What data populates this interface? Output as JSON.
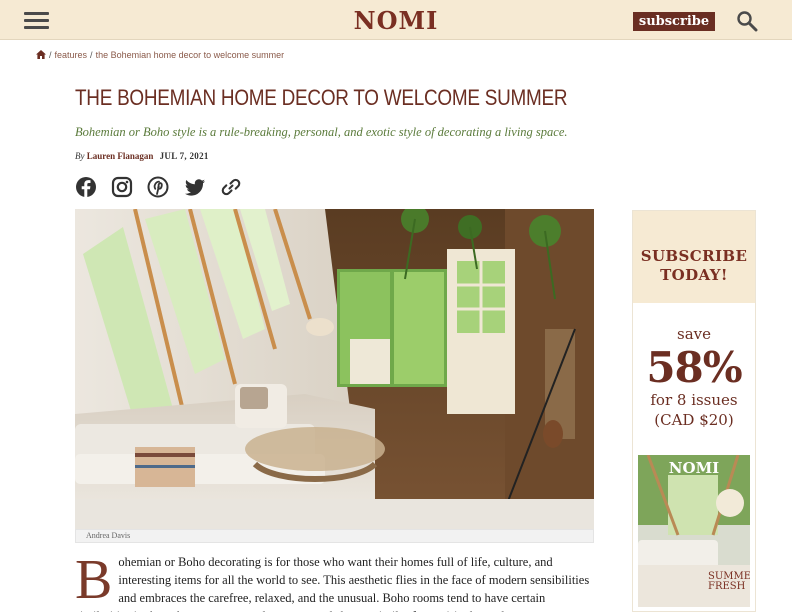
{
  "header": {
    "brand": "NOMI",
    "subscribe_label": "subscribe",
    "menu_icon": "hamburger-menu-icon",
    "search_icon": "search-icon"
  },
  "breadcrumb": {
    "home_icon": "home-icon",
    "items": [
      "features",
      "the Bohemian home decor to welcome summer"
    ]
  },
  "article": {
    "title": "THE BOHEMIAN HOME DECOR TO WELCOME SUMMER",
    "subtitle": "Bohemian or Boho style is a rule-breaking, personal, and exotic style of decorating a living space.",
    "byline_prefix": "By",
    "author": "Lauren Flanagan",
    "date": "JUL 7, 2021",
    "share_icons": [
      "facebook-icon",
      "instagram-icon",
      "pinterest-icon",
      "twitter-icon",
      "link-icon"
    ],
    "photo_credit": "Andrea Davis",
    "dropcap": "B",
    "body": "ohemian or Boho decorating is for those who want their homes full of life, culture, and interesting items for all the world to see. This aesthetic flies in the face of modern sensibilities and embraces the carefree, relaxed, and the unusual. Boho rooms tend to have certain similarities in the colors, textures, and patterns, and share a similar free-spirited mood."
  },
  "sidebar": {
    "heading_line1": "SUBSCRIBE",
    "heading_line2": "TODAY!",
    "save": "save",
    "percent": "58%",
    "issues": "for 8 issues",
    "price": "(CAD $20)",
    "cover": {
      "brand": "NOMI",
      "line": "SUMMER",
      "line2": "FRESH"
    }
  },
  "colors": {
    "brand": "#7a2f22",
    "header_bg": "#f6ead3",
    "subtitle": "#5a7a3a"
  }
}
